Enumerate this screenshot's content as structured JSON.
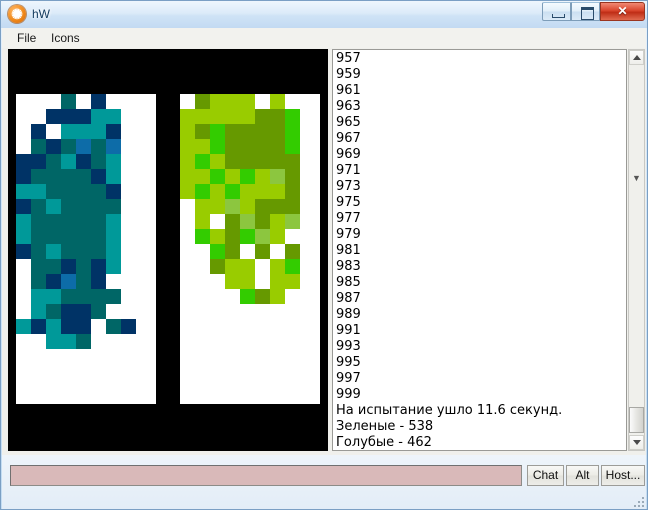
{
  "window": {
    "title": "hW",
    "icon": "atom-icon",
    "controls": {
      "minimize_label": "–",
      "maximize_label": "□",
      "close_label": "✕"
    }
  },
  "menubar": {
    "items": [
      {
        "label": "File",
        "name": "menu-file"
      },
      {
        "label": "Icons",
        "name": "menu-icons"
      }
    ]
  },
  "log_panel": {
    "lines": [
      "957",
      "959",
      "961",
      "963",
      "965",
      "967",
      "969",
      "971",
      "973",
      "975",
      "977",
      "979",
      "981",
      "983",
      "985",
      "987",
      "989",
      "991",
      "993",
      "995",
      "997",
      "999",
      "На испытание ушло 11.6 секунд.",
      "Зеленые - 538",
      "Голубые - 462"
    ],
    "summary": {
      "elapsed_text": "На испытание ушло 11.6 секунд.",
      "elapsed_seconds": 11.6,
      "green_label": "Зеленые",
      "green_count": 538,
      "blue_label": "Голубые",
      "blue_count": 462
    }
  },
  "scrollbar": {
    "up_arrow": "▲",
    "down_arrow": "▼",
    "position": "bottom"
  },
  "chat": {
    "input_value": "",
    "input_placeholder": "",
    "input_color": "#d9b9b9"
  },
  "buttons": [
    {
      "label": "Chat",
      "name": "chat-button"
    },
    {
      "label": "Alt",
      "name": "alt-button"
    },
    {
      "label": "Host...",
      "name": "host-button"
    }
  ],
  "simulation": {
    "cell_size": 15,
    "cols": 10,
    "rows": 22,
    "background": "#000000",
    "empty": "#ffffff",
    "blue_palette": {
      "navy": "#003366",
      "deep": "#006666",
      "teal": "#009999",
      "cyan": "#00a0a8",
      "steel": "#0d6ca8",
      "dark": "#014d66"
    },
    "green_palette": {
      "yellowgreen": "#99cc00",
      "bright": "#33cc00",
      "olive": "#669900",
      "lime": "#22c400",
      "pale": "#8cc63f",
      "grass": "#55aa11"
    },
    "blue_cells": [
      [
        3,
        0,
        "#006666"
      ],
      [
        3,
        1,
        "#006666"
      ],
      [
        3,
        2,
        "#006666"
      ],
      [
        3,
        3,
        "#006666"
      ],
      [
        5,
        0,
        "#003366"
      ],
      [
        2,
        1,
        "#003366"
      ],
      [
        3,
        1,
        "#003366"
      ],
      [
        4,
        1,
        "#003366"
      ],
      [
        5,
        1,
        "#009999"
      ],
      [
        6,
        1,
        "#009999"
      ],
      [
        1,
        2,
        "#003366"
      ],
      [
        3,
        2,
        "#009999"
      ],
      [
        4,
        2,
        "#009999"
      ],
      [
        5,
        2,
        "#009999"
      ],
      [
        6,
        2,
        "#003366"
      ],
      [
        1,
        3,
        "#006666"
      ],
      [
        2,
        3,
        "#003366"
      ],
      [
        3,
        3,
        "#006666"
      ],
      [
        4,
        3,
        "#0d6ca8"
      ],
      [
        5,
        3,
        "#006666"
      ],
      [
        6,
        3,
        "#0d6ca8"
      ],
      [
        0,
        4,
        "#003366"
      ],
      [
        1,
        4,
        "#003366"
      ],
      [
        2,
        4,
        "#006666"
      ],
      [
        3,
        4,
        "#009999"
      ],
      [
        4,
        4,
        "#003366"
      ],
      [
        5,
        4,
        "#006666"
      ],
      [
        6,
        4,
        "#009999"
      ],
      [
        0,
        5,
        "#003366"
      ],
      [
        1,
        5,
        "#006666"
      ],
      [
        2,
        5,
        "#006666"
      ],
      [
        3,
        5,
        "#006666"
      ],
      [
        4,
        5,
        "#006666"
      ],
      [
        5,
        5,
        "#003366"
      ],
      [
        6,
        5,
        "#009999"
      ],
      [
        0,
        6,
        "#009999"
      ],
      [
        1,
        6,
        "#009999"
      ],
      [
        2,
        6,
        "#006666"
      ],
      [
        3,
        6,
        "#006666"
      ],
      [
        4,
        6,
        "#006666"
      ],
      [
        5,
        6,
        "#006666"
      ],
      [
        6,
        6,
        "#003366"
      ],
      [
        0,
        7,
        "#003366"
      ],
      [
        1,
        7,
        "#006666"
      ],
      [
        2,
        7,
        "#009999"
      ],
      [
        3,
        7,
        "#006666"
      ],
      [
        4,
        7,
        "#006666"
      ],
      [
        5,
        7,
        "#006666"
      ],
      [
        6,
        7,
        "#006666"
      ],
      [
        0,
        8,
        "#009999"
      ],
      [
        1,
        8,
        "#006666"
      ],
      [
        2,
        8,
        "#006666"
      ],
      [
        3,
        8,
        "#006666"
      ],
      [
        4,
        8,
        "#006666"
      ],
      [
        5,
        8,
        "#006666"
      ],
      [
        6,
        8,
        "#009999"
      ],
      [
        0,
        9,
        "#009999"
      ],
      [
        1,
        9,
        "#006666"
      ],
      [
        2,
        9,
        "#006666"
      ],
      [
        3,
        9,
        "#006666"
      ],
      [
        4,
        9,
        "#006666"
      ],
      [
        5,
        9,
        "#006666"
      ],
      [
        6,
        9,
        "#009999"
      ],
      [
        0,
        10,
        "#003366"
      ],
      [
        1,
        10,
        "#006666"
      ],
      [
        2,
        10,
        "#009999"
      ],
      [
        3,
        10,
        "#006666"
      ],
      [
        4,
        10,
        "#006666"
      ],
      [
        5,
        10,
        "#006666"
      ],
      [
        6,
        10,
        "#009999"
      ],
      [
        1,
        11,
        "#006666"
      ],
      [
        2,
        11,
        "#006666"
      ],
      [
        3,
        11,
        "#003366"
      ],
      [
        4,
        11,
        "#006666"
      ],
      [
        5,
        11,
        "#003366"
      ],
      [
        6,
        11,
        "#009999"
      ],
      [
        1,
        12,
        "#006666"
      ],
      [
        2,
        12,
        "#003366"
      ],
      [
        3,
        12,
        "#0d6ca8"
      ],
      [
        4,
        12,
        "#006666"
      ],
      [
        5,
        12,
        "#003366"
      ],
      [
        1,
        13,
        "#009999"
      ],
      [
        2,
        13,
        "#009999"
      ],
      [
        3,
        13,
        "#006666"
      ],
      [
        4,
        13,
        "#006666"
      ],
      [
        5,
        13,
        "#006666"
      ],
      [
        6,
        13,
        "#006666"
      ],
      [
        1,
        14,
        "#009999"
      ],
      [
        2,
        14,
        "#006666"
      ],
      [
        3,
        14,
        "#003366"
      ],
      [
        4,
        14,
        "#003366"
      ],
      [
        5,
        14,
        "#006666"
      ],
      [
        0,
        15,
        "#009999"
      ],
      [
        1,
        15,
        "#003366"
      ],
      [
        2,
        15,
        "#009999"
      ],
      [
        3,
        15,
        "#003366"
      ],
      [
        4,
        15,
        "#003366"
      ],
      [
        6,
        15,
        "#006666"
      ],
      [
        7,
        15,
        "#003366"
      ],
      [
        2,
        16,
        "#009999"
      ],
      [
        3,
        16,
        "#009999"
      ],
      [
        4,
        16,
        "#006666"
      ]
    ],
    "green_cells": [
      [
        1,
        0,
        "#669900"
      ],
      [
        2,
        0,
        "#99cc00"
      ],
      [
        3,
        0,
        "#99cc00"
      ],
      [
        4,
        0,
        "#99cc00"
      ],
      [
        6,
        0,
        "#99cc00"
      ],
      [
        0,
        1,
        "#99cc00"
      ],
      [
        1,
        1,
        "#99cc00"
      ],
      [
        2,
        1,
        "#99cc00"
      ],
      [
        3,
        1,
        "#99cc00"
      ],
      [
        4,
        1,
        "#99cc00"
      ],
      [
        5,
        1,
        "#669900"
      ],
      [
        6,
        1,
        "#669900"
      ],
      [
        7,
        1,
        "#33cc00"
      ],
      [
        0,
        2,
        "#99cc00"
      ],
      [
        1,
        2,
        "#669900"
      ],
      [
        2,
        2,
        "#33cc00"
      ],
      [
        3,
        2,
        "#669900"
      ],
      [
        4,
        2,
        "#669900"
      ],
      [
        5,
        2,
        "#669900"
      ],
      [
        6,
        2,
        "#669900"
      ],
      [
        7,
        2,
        "#33cc00"
      ],
      [
        0,
        3,
        "#99cc00"
      ],
      [
        1,
        3,
        "#99cc00"
      ],
      [
        2,
        3,
        "#33cc00"
      ],
      [
        3,
        3,
        "#669900"
      ],
      [
        4,
        3,
        "#669900"
      ],
      [
        5,
        3,
        "#669900"
      ],
      [
        6,
        3,
        "#669900"
      ],
      [
        7,
        3,
        "#33cc00"
      ],
      [
        0,
        4,
        "#99cc00"
      ],
      [
        1,
        4,
        "#33cc00"
      ],
      [
        2,
        4,
        "#99cc00"
      ],
      [
        3,
        4,
        "#669900"
      ],
      [
        4,
        4,
        "#669900"
      ],
      [
        5,
        4,
        "#669900"
      ],
      [
        6,
        4,
        "#669900"
      ],
      [
        7,
        4,
        "#669900"
      ],
      [
        0,
        5,
        "#99cc00"
      ],
      [
        1,
        5,
        "#99cc00"
      ],
      [
        2,
        5,
        "#33cc00"
      ],
      [
        3,
        5,
        "#99cc00"
      ],
      [
        4,
        5,
        "#33cc00"
      ],
      [
        5,
        5,
        "#99cc00"
      ],
      [
        6,
        5,
        "#8cc63f"
      ],
      [
        7,
        5,
        "#669900"
      ],
      [
        0,
        6,
        "#99cc00"
      ],
      [
        1,
        6,
        "#33cc00"
      ],
      [
        2,
        6,
        "#99cc00"
      ],
      [
        3,
        6,
        "#33cc00"
      ],
      [
        4,
        6,
        "#99cc00"
      ],
      [
        5,
        6,
        "#99cc00"
      ],
      [
        6,
        6,
        "#99cc00"
      ],
      [
        7,
        6,
        "#669900"
      ],
      [
        1,
        7,
        "#99cc00"
      ],
      [
        2,
        7,
        "#99cc00"
      ],
      [
        3,
        7,
        "#8cc63f"
      ],
      [
        4,
        7,
        "#99cc00"
      ],
      [
        5,
        7,
        "#669900"
      ],
      [
        6,
        7,
        "#669900"
      ],
      [
        7,
        7,
        "#669900"
      ],
      [
        1,
        8,
        "#99cc00"
      ],
      [
        3,
        8,
        "#669900"
      ],
      [
        4,
        8,
        "#8cc63f"
      ],
      [
        5,
        8,
        "#669900"
      ],
      [
        6,
        8,
        "#99cc00"
      ],
      [
        7,
        8,
        "#8cc63f"
      ],
      [
        1,
        9,
        "#33cc00"
      ],
      [
        2,
        9,
        "#99cc00"
      ],
      [
        3,
        9,
        "#669900"
      ],
      [
        4,
        9,
        "#33cc00"
      ],
      [
        5,
        9,
        "#8cc63f"
      ],
      [
        6,
        9,
        "#99cc00"
      ],
      [
        2,
        10,
        "#33cc00"
      ],
      [
        3,
        10,
        "#669900"
      ],
      [
        5,
        10,
        "#669900"
      ],
      [
        7,
        10,
        "#669900"
      ],
      [
        2,
        11,
        "#669900"
      ],
      [
        3,
        11,
        "#99cc00"
      ],
      [
        4,
        11,
        "#99cc00"
      ],
      [
        6,
        11,
        "#99cc00"
      ],
      [
        7,
        11,
        "#33cc00"
      ],
      [
        3,
        12,
        "#99cc00"
      ],
      [
        4,
        12,
        "#99cc00"
      ],
      [
        6,
        12,
        "#99cc00"
      ],
      [
        7,
        12,
        "#99cc00"
      ],
      [
        4,
        13,
        "#33cc00"
      ],
      [
        5,
        13,
        "#669900"
      ],
      [
        6,
        13,
        "#99cc00"
      ]
    ]
  }
}
